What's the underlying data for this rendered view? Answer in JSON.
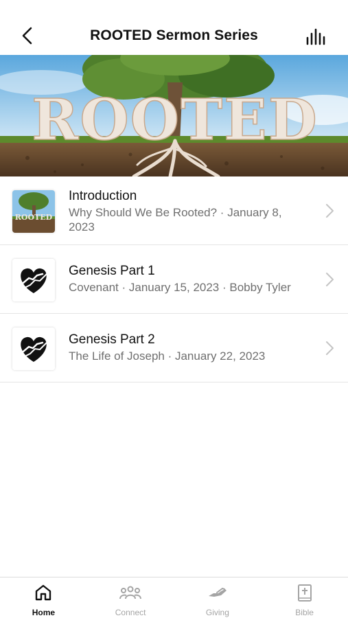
{
  "header": {
    "title": "ROOTED Sermon Series",
    "back_icon": "chevron-left-icon",
    "audio_icon": "audio-bars-icon"
  },
  "hero": {
    "text": "ROOTED"
  },
  "sermons": [
    {
      "title": "Introduction",
      "subtitle": "Why Should We Be Rooted? · January 8, 2023",
      "thumbnail": "tree-thumbnail"
    },
    {
      "title": "Genesis Part 1",
      "subtitle": "Covenant · January 15, 2023 · Bobby Tyler",
      "thumbnail": "heart-hands-thumbnail"
    },
    {
      "title": "Genesis Part 2",
      "subtitle": "The Life of Joseph · January 22, 2023",
      "thumbnail": "heart-hands-thumbnail"
    }
  ],
  "tabs": [
    {
      "label": "Home",
      "icon": "home-icon",
      "active": true
    },
    {
      "label": "Connect",
      "icon": "people-icon",
      "active": false
    },
    {
      "label": "Giving",
      "icon": "giving-hand-icon",
      "active": false
    },
    {
      "label": "Bible",
      "icon": "bible-icon",
      "active": false
    }
  ],
  "colors": {
    "accent": "#111111",
    "inactive": "#a4a4a4",
    "subtitle": "#6f6f6f"
  }
}
